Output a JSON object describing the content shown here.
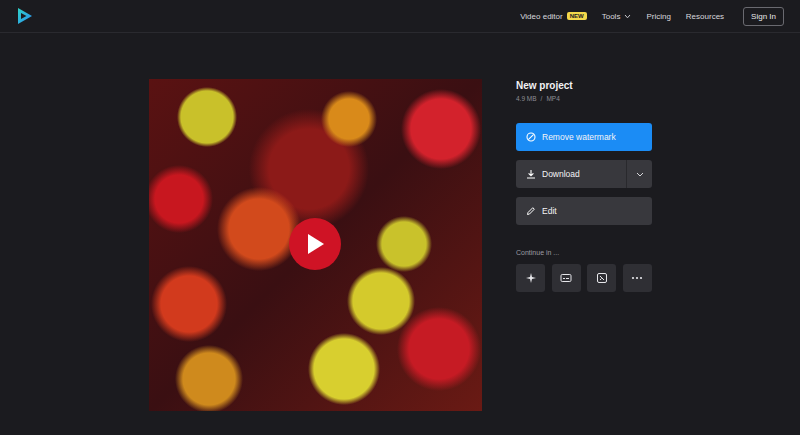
{
  "header": {
    "nav": [
      {
        "label": "Video editor",
        "badge": "NEW",
        "kind": "badge"
      },
      {
        "label": "Tools",
        "kind": "menu"
      },
      {
        "label": "Pricing",
        "kind": "link"
      },
      {
        "label": "Resources",
        "kind": "link"
      }
    ],
    "sign_in": "Sign In"
  },
  "project": {
    "title": "New project",
    "size": "4.9 MB",
    "separator": "/",
    "format": "MP4"
  },
  "actions": [
    {
      "label": "Remove watermark",
      "kind": "primary"
    },
    {
      "label": "Download",
      "kind": "split"
    },
    {
      "label": "Edit",
      "kind": "plain"
    }
  ],
  "continue": {
    "label": "Continue in ..."
  }
}
